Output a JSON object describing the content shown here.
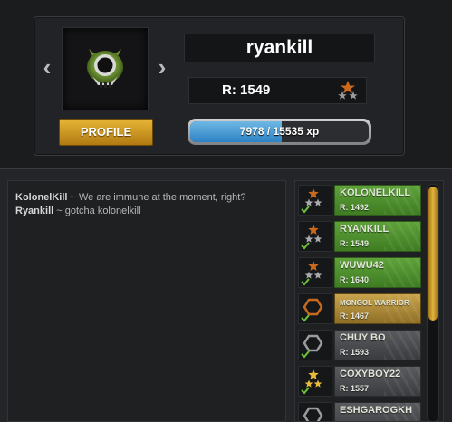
{
  "profile": {
    "username": "ryankill",
    "rating_label": "R: 1549",
    "profile_button": "PROFILE",
    "xp_text": "7978 / 15535 xp",
    "xp_fraction": 0.5136,
    "rank_icon": "rank-stars-icon",
    "avatar_icon": "skull-avatar-icon",
    "prev_icon": "chevron-left-icon",
    "next_icon": "chevron-right-icon"
  },
  "chat": {
    "messages": [
      {
        "user": "KolonelKill",
        "sep": " ~ ",
        "text": "We are immune at the moment, right?"
      },
      {
        "user": "Ryankill",
        "sep": " ~ ",
        "text": "gotcha kolonelkill"
      }
    ]
  },
  "players": [
    {
      "name": "KOLONELKILL",
      "rating": "R: 1492",
      "style": "green",
      "rank": "stars-bronze"
    },
    {
      "name": "RYANKILL",
      "rating": "R: 1549",
      "style": "green",
      "rank": "stars-bronze"
    },
    {
      "name": "WUWU42",
      "rating": "R: 1640",
      "style": "green",
      "rank": "stars-bronze"
    },
    {
      "name": "MONGOL WARRIOR",
      "rating": "R: 1467",
      "style": "gold",
      "rank": "hexagon-bronze"
    },
    {
      "name": "CHUY BO",
      "rating": "R: 1593",
      "style": "gray",
      "rank": "hexagon-silver"
    },
    {
      "name": "COXYBOY22",
      "rating": "R: 1557",
      "style": "gray",
      "rank": "stars-gold"
    },
    {
      "name": "ESHGAROGKH",
      "rating": "",
      "style": "gray",
      "rank": "hexagon-silver"
    }
  ],
  "colors": {
    "accent_gold": "#d9a52d",
    "xp_blue": "#3d92d0",
    "player_green": "#4f9130"
  }
}
